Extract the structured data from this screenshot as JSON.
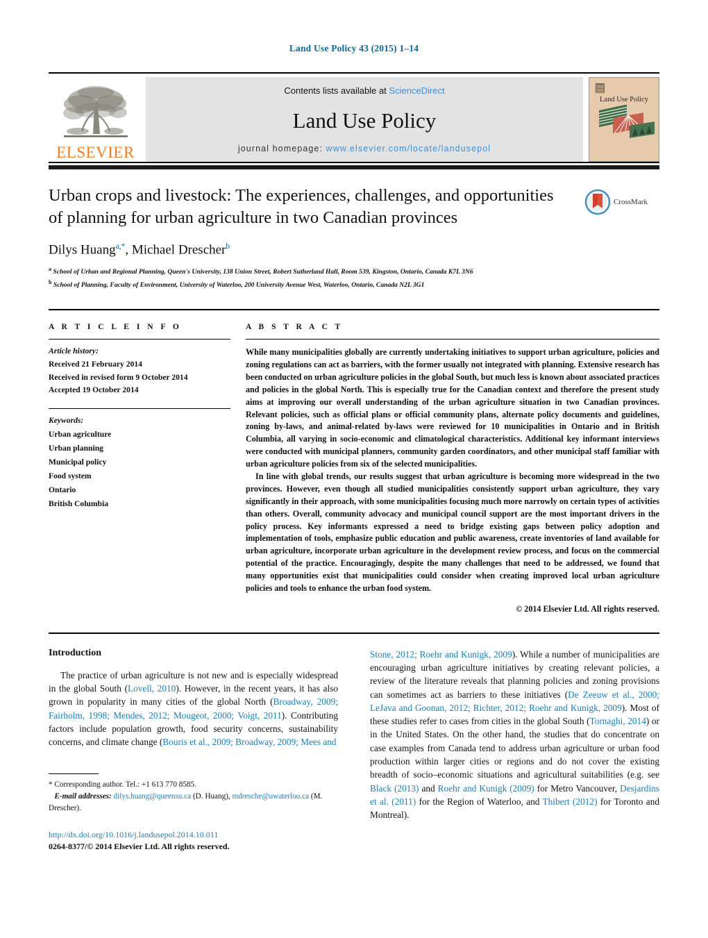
{
  "running_head": "Land Use Policy 43 (2015) 1–14",
  "masthead": {
    "publisher_name": "ELSEVIER",
    "publisher_logo": "elsevier-tree-logo",
    "contents_prefix": "Contents lists available at ",
    "sciencedirect": "ScienceDirect",
    "journal_name": "Land Use Policy",
    "homepage_prefix": "journal homepage: ",
    "homepage_url": "www.elsevier.com/locate/landusepol",
    "cover_title": "Land Use Policy",
    "accent_orange": "#F47B20",
    "link_blue": "#3f8fd0",
    "band_gray": "#e3e3e3",
    "cover_bg": "#e7c9ac"
  },
  "article": {
    "title": "Urban crops and livestock: The experiences, challenges, and opportunities of planning for urban agriculture in two Canadian provinces",
    "authors_plain": "Dilys Huang",
    "author1": "Dilys Huang",
    "author1_sup": "a,*",
    "author2": "Michael Drescher",
    "author2_sup": "b",
    "affiliation_a_sup": "a",
    "affiliation_a": "School of Urban and Regional Planning, Queen's University, 138 Union Street, Robert Sutherland Hall, Room 539, Kingston, Ontario, Canada K7L 3N6",
    "affiliation_b_sup": "b",
    "affiliation_b": "School of Planning, Faculty of Environment, University of Waterloo, 200 University Avenue West, Waterloo, Ontario, Canada N2L 3G1",
    "crossmark_label": "CrossMark"
  },
  "article_info": {
    "heading": "A R T I C L E  I N F O",
    "history_label": "Article history:",
    "history": [
      "Received 21 February 2014",
      "Received in revised form 9 October 2014",
      "Accepted 19 October 2014"
    ],
    "keywords_label": "Keywords:",
    "keywords": [
      "Urban agriculture",
      "Urban planning",
      "Municipal policy",
      "Food system",
      "Ontario",
      "British Columbia"
    ]
  },
  "abstract": {
    "heading": "A B S T R A C T",
    "paragraph1": "While many municipalities globally are currently undertaking initiatives to support urban agriculture, policies and zoning regulations can act as barriers, with the former usually not integrated with planning. Extensive research has been conducted on urban agriculture policies in the global South, but much less is known about associated practices and policies in the global North. This is especially true for the Canadian context and therefore the present study aims at improving our overall understanding of the urban agriculture situation in two Canadian provinces. Relevant policies, such as official plans or official community plans, alternate policy documents and guidelines, zoning by-laws, and animal-related by-laws were reviewed for 10 municipalities in Ontario and in British Columbia, all varying in socio-economic and climatological characteristics. Additional key informant interviews were conducted with municipal planners, community garden coordinators, and other municipal staff familiar with urban agriculture policies from six of the selected municipalities.",
    "paragraph2": "In line with global trends, our results suggest that urban agriculture is becoming more widespread in the two provinces. However, even though all studied municipalities consistently support urban agriculture, they vary significantly in their approach, with some municipalities focusing much more narrowly on certain types of activities than others. Overall, community advocacy and municipal council support are the most important drivers in the policy process. Key informants expressed a need to bridge existing gaps between policy adoption and implementation of tools, emphasize public education and public awareness, create inventories of land available for urban agriculture, incorporate urban agriculture in the development review process, and focus on the commercial potential of the practice. Encouragingly, despite the many challenges that need to be addressed, we found that many opportunities exist that municipalities could consider when creating improved local urban agriculture policies and tools to enhance the urban food system.",
    "copyright": "© 2014 Elsevier Ltd. All rights reserved."
  },
  "introduction": {
    "heading": "Introduction",
    "left_para_html": "The practice of urban agriculture is not new and is especially widespread in the global South (<span class=\"ref\">Lovell, 2010</span>). However, in the recent years, it has also grown in popularity in many cities of the global North (<span class=\"ref\">Broadway, 2009; Fairholm, 1998; Mendes, 2012; Mougeot, 2000; Voigt, 2011</span>). Contributing factors include population growth, food security concerns, sustainability concerns, and climate change (<span class=\"ref\">Bouris et al., 2009; Broadway, 2009; Mees and</span>",
    "right_para_html": "<span class=\"ref\">Stone, 2012; Roehr and Kunigk, 2009</span>). While a number of municipalities are encouraging urban agriculture initiatives by creating relevant policies, a review of the literature reveals that planning policies and zoning provisions can sometimes act as barriers to these initiatives (<span class=\"ref\">De Zeeuw et al., 2000; LeJava and Goonan, 2012; Richter, 2012; Roehr and Kunigk, 2009</span>). Most of these studies refer to cases from cities in the global South (<span class=\"ref\">Tornaghi, 2014</span>) or in the United States. On the other hand, the studies that do concentrate on case examples from Canada tend to address urban agriculture or urban food production within larger cities or regions and do not cover the existing breadth of socio–economic situations and agricultural suitabilities (e.g. see <span class=\"ref\">Black (2013)</span> and <span class=\"ref\">Roehr and Kunigk (2009)</span> for Metro Vancouver, <span class=\"ref\">Desjardins et al. (2011)</span> for the Region of Waterloo, and <span class=\"ref\">Thibert (2012)</span> for Toronto and Montreal)."
  },
  "footnotes": {
    "corresponding_html": "* Corresponding author. Tel.: +1 613 770 8585.",
    "email_label": "E-mail addresses:",
    "email1": "dilys.huang@queensu.ca",
    "email1_owner": "(D. Huang),",
    "email2": "mdresche@uwaterloo.ca",
    "email2_owner": "(M. Drescher).",
    "doi": "http://dx.doi.org/10.1016/j.landusepol.2014.10.011",
    "issn_line": "0264-8377/© 2014 Elsevier Ltd. All rights reserved."
  }
}
